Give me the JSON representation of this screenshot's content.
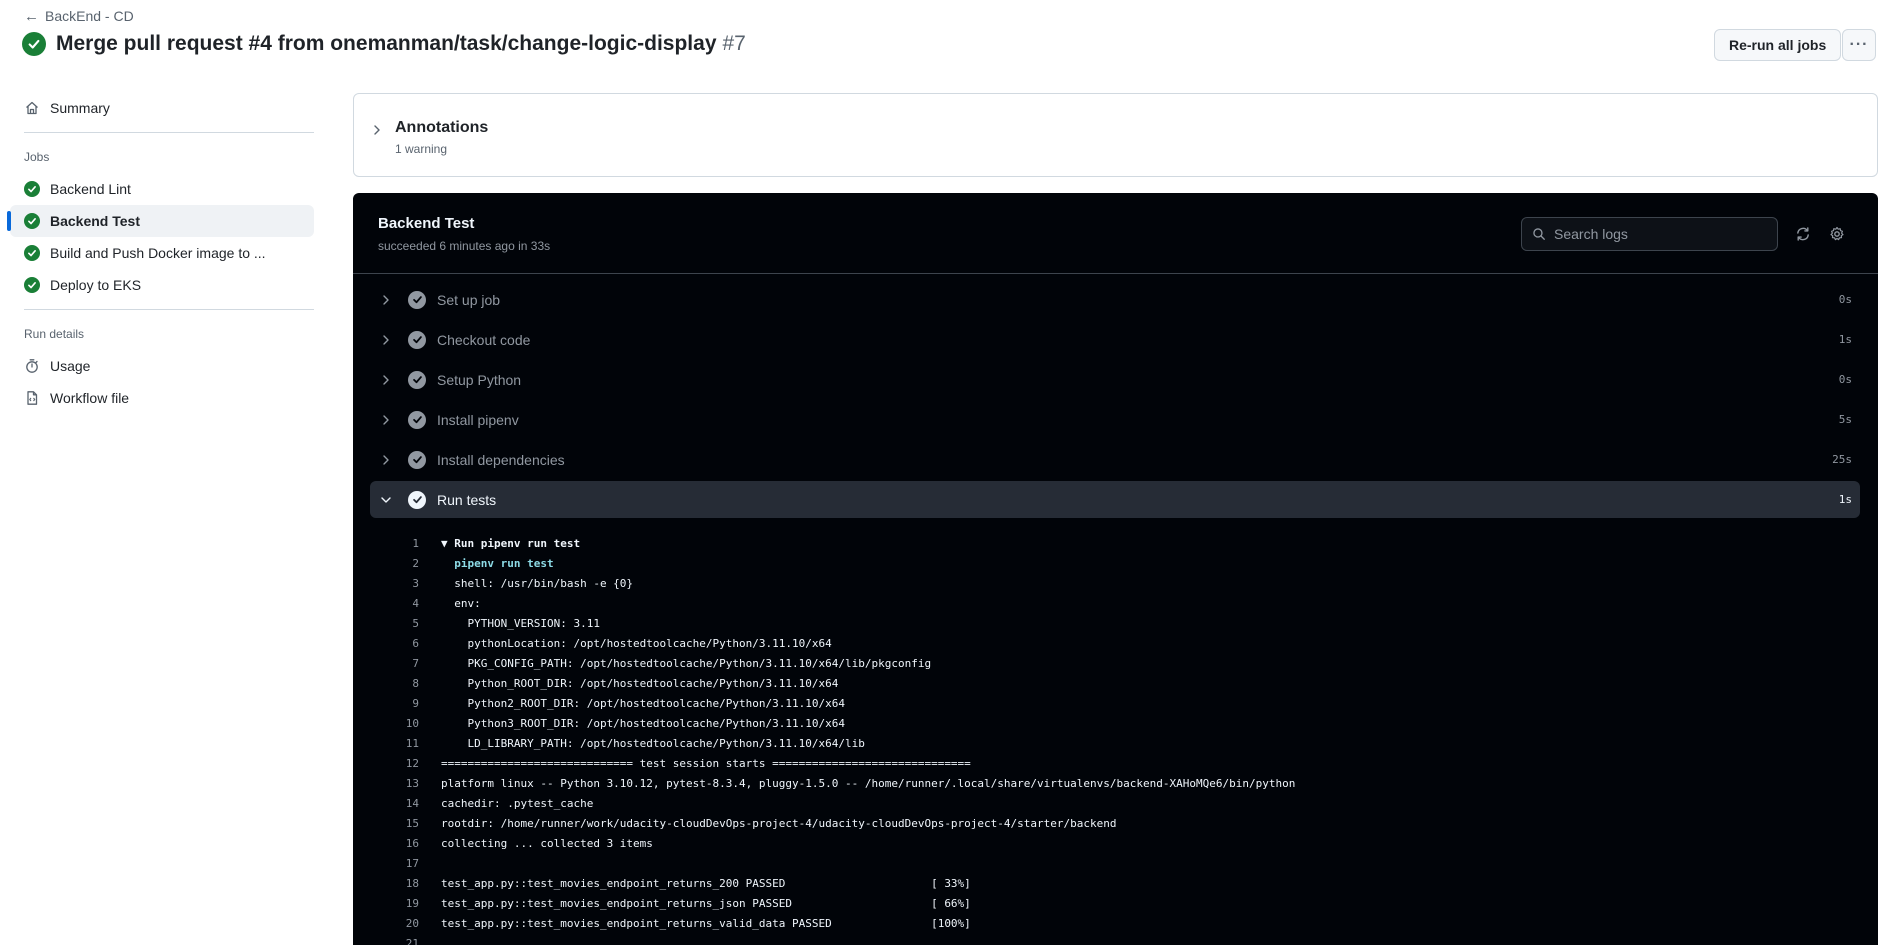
{
  "header": {
    "back_label": "BackEnd - CD",
    "title": "Merge pull request #4 from onemanman/task/change-logic-display",
    "run_number": "#7",
    "rerun_label": "Re-run all jobs",
    "more_label": "···"
  },
  "sidebar": {
    "summary_label": "Summary",
    "jobs_heading": "Jobs",
    "jobs": [
      {
        "label": "Backend Lint",
        "status": "success"
      },
      {
        "label": "Backend Test",
        "status": "success",
        "active": true
      },
      {
        "label": "Build and Push Docker image to ...",
        "status": "success"
      },
      {
        "label": "Deploy to EKS",
        "status": "success"
      }
    ],
    "run_details_heading": "Run details",
    "usage_label": "Usage",
    "workflow_label": "Workflow file"
  },
  "annotations": {
    "title": "Annotations",
    "subtitle": "1 warning"
  },
  "job": {
    "title": "Backend Test",
    "subtitle": "succeeded 6 minutes ago in 33s",
    "search_placeholder": "Search logs",
    "steps": [
      {
        "name": "Set up job",
        "duration": "0s"
      },
      {
        "name": "Checkout code",
        "duration": "1s"
      },
      {
        "name": "Setup Python",
        "duration": "0s"
      },
      {
        "name": "Install pipenv",
        "duration": "5s"
      },
      {
        "name": "Install dependencies",
        "duration": "25s"
      },
      {
        "name": "Run tests",
        "duration": "1s",
        "open": true
      }
    ],
    "log_lines": [
      {
        "n": "1",
        "text": "▼ Run pipenv run test",
        "style": "bold"
      },
      {
        "n": "2",
        "text": "  pipenv run test",
        "style": "cmd"
      },
      {
        "n": "3",
        "text": "  shell: /usr/bin/bash -e {0}",
        "style": ""
      },
      {
        "n": "4",
        "text": "  env:",
        "style": ""
      },
      {
        "n": "5",
        "text": "    PYTHON_VERSION: 3.11",
        "style": ""
      },
      {
        "n": "6",
        "text": "    pythonLocation: /opt/hostedtoolcache/Python/3.11.10/x64",
        "style": ""
      },
      {
        "n": "7",
        "text": "    PKG_CONFIG_PATH: /opt/hostedtoolcache/Python/3.11.10/x64/lib/pkgconfig",
        "style": ""
      },
      {
        "n": "8",
        "text": "    Python_ROOT_DIR: /opt/hostedtoolcache/Python/3.11.10/x64",
        "style": ""
      },
      {
        "n": "9",
        "text": "    Python2_ROOT_DIR: /opt/hostedtoolcache/Python/3.11.10/x64",
        "style": ""
      },
      {
        "n": "10",
        "text": "    Python3_ROOT_DIR: /opt/hostedtoolcache/Python/3.11.10/x64",
        "style": ""
      },
      {
        "n": "11",
        "text": "    LD_LIBRARY_PATH: /opt/hostedtoolcache/Python/3.11.10/x64/lib",
        "style": ""
      },
      {
        "n": "12",
        "text": "============================= test session starts ==============================",
        "style": ""
      },
      {
        "n": "13",
        "text": "platform linux -- Python 3.10.12, pytest-8.3.4, pluggy-1.5.0 -- /home/runner/.local/share/virtualenvs/backend-XAHoMQe6/bin/python",
        "style": ""
      },
      {
        "n": "14",
        "text": "cachedir: .pytest_cache",
        "style": ""
      },
      {
        "n": "15",
        "text": "rootdir: /home/runner/work/udacity-cloudDevOps-project-4/udacity-cloudDevOps-project-4/starter/backend",
        "style": ""
      },
      {
        "n": "16",
        "text": "collecting ... collected 3 items",
        "style": ""
      },
      {
        "n": "17",
        "text": "",
        "style": ""
      },
      {
        "n": "18",
        "text": "test_app.py::test_movies_endpoint_returns_200 PASSED                      [ 33%]",
        "style": ""
      },
      {
        "n": "19",
        "text": "test_app.py::test_movies_endpoint_returns_json PASSED                     [ 66%]",
        "style": ""
      },
      {
        "n": "20",
        "text": "test_app.py::test_movies_endpoint_returns_valid_data PASSED               [100%]",
        "style": ""
      },
      {
        "n": "21",
        "text": "",
        "style": ""
      }
    ]
  },
  "colors": {
    "success": "#1a7f37",
    "accent": "#0969da",
    "log_bg": "#010409",
    "log_cmd": "#8ddbe6"
  },
  "icons": {
    "back": "arrow-left-icon",
    "summary": "home-icon",
    "usage": "stopwatch-icon",
    "workflow": "file-icon",
    "refresh": "sync-icon",
    "settings": "gear-icon",
    "search": "search-icon"
  }
}
